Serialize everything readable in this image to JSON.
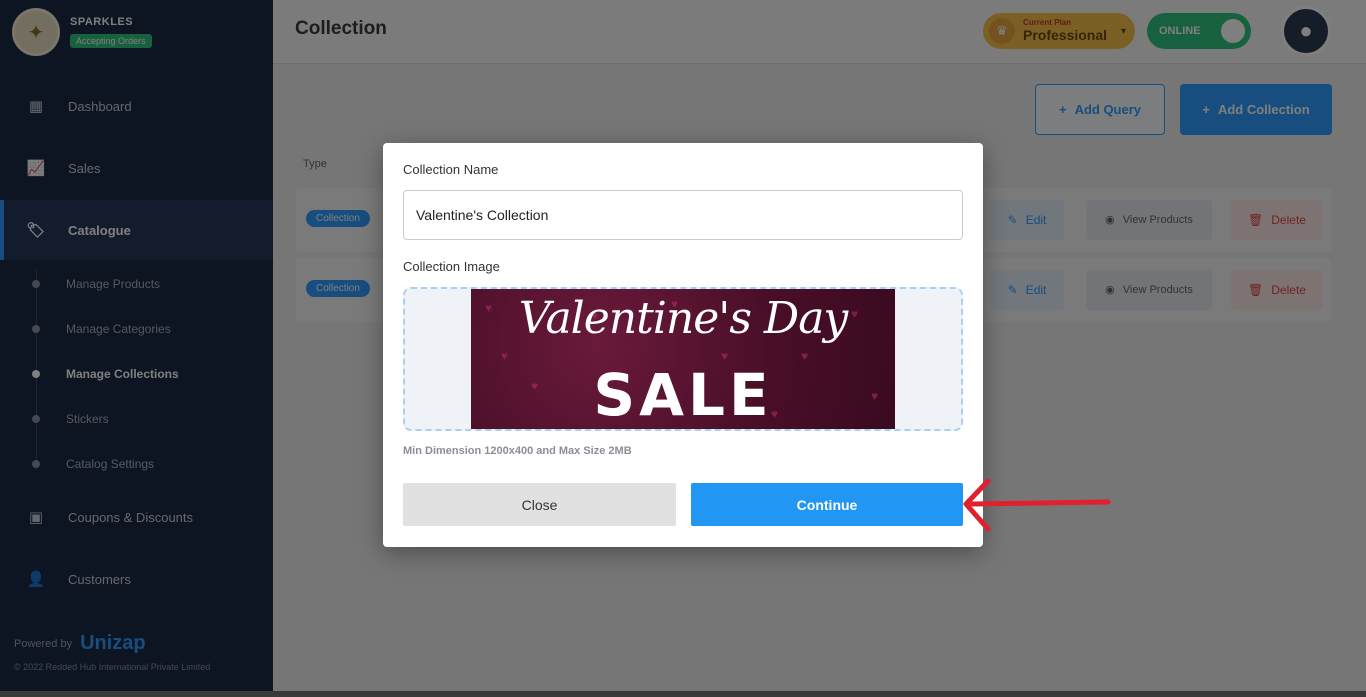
{
  "sidebar": {
    "brand_name": "SPARKLES",
    "brand_badge": "Accepting Orders",
    "items": [
      {
        "label": "Dashboard",
        "icon": "grid-icon"
      },
      {
        "label": "Sales",
        "icon": "chart-icon"
      },
      {
        "label": "Catalogue",
        "icon": "tag-icon"
      },
      {
        "label": "Coupons & Discounts",
        "icon": "ticket-icon"
      },
      {
        "label": "Customers",
        "icon": "user-icon"
      }
    ],
    "subitems": [
      {
        "label": "Manage Products"
      },
      {
        "label": "Manage Categories"
      },
      {
        "label": "Manage Collections"
      },
      {
        "label": "Stickers"
      },
      {
        "label": "Catalog Settings"
      }
    ],
    "powered_by": "Powered by",
    "powered_logo": "Unizap",
    "copyright": "© 2022 Redded Hub International Private Limited"
  },
  "topbar": {
    "title": "Collection",
    "plan_small": "Current Plan",
    "plan_name": "Professional",
    "online_label": "ONLINE"
  },
  "main": {
    "add_query_label": "Add Query",
    "add_collection_label": "Add Collection",
    "type_header": "Type",
    "rows": [
      {
        "chip": "Collection",
        "edit": "Edit",
        "view": "View Products",
        "delete": "Delete"
      },
      {
        "chip": "Collection",
        "edit": "Edit",
        "view": "View Products",
        "delete": "Delete"
      }
    ]
  },
  "modal": {
    "name_label": "Collection Name",
    "name_value": "Valentine's Collection",
    "image_label": "Collection Image",
    "banner_script": "Valentine's Day",
    "banner_sale": "SALE",
    "hint": "Min Dimension 1200x400 and Max Size 2MB",
    "close_label": "Close",
    "continue_label": "Continue"
  },
  "colors": {
    "sidebar_bg": "#1a2a44",
    "primary": "#2196f3",
    "annotation_arrow": "#e0202e"
  }
}
